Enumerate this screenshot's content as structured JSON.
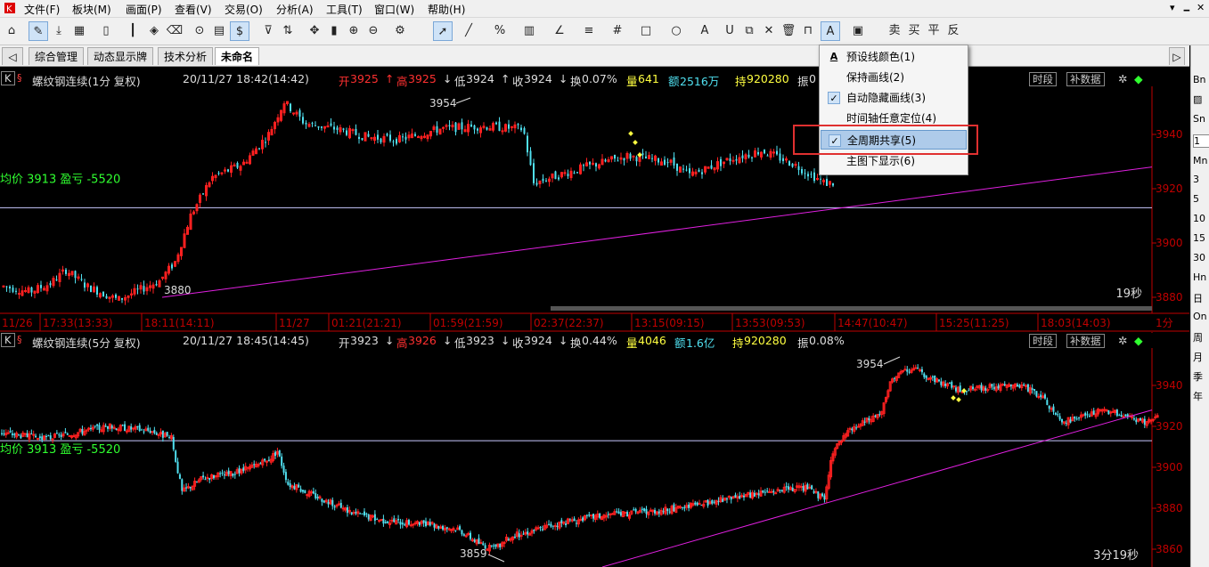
{
  "menu": [
    "文件(F)",
    "板块(M)",
    "画面(P)",
    "查看(V)",
    "交易(O)",
    "分析(A)",
    "工具(T)",
    "窗口(W)",
    "帮助(H)"
  ],
  "window_controls": {
    "restore": "▾",
    "min": "🗕",
    "close": "✕"
  },
  "toolbar": {
    "sell": "卖",
    "buy": "买",
    "flat": "平",
    "reverse": "反"
  },
  "tabs": [
    "综合管理",
    "动态显示牌",
    "技术分析",
    "未命名"
  ],
  "sidebar": [
    "Bn",
    "",
    "Sn",
    "1",
    "Mn",
    "3",
    "5",
    "10",
    "15",
    "30",
    "Hn",
    "日",
    "On",
    "周",
    "月",
    "季",
    "年"
  ],
  "chart1": {
    "k_btn": "K",
    "instrument": "螺纹钢连续(1分 复权)",
    "datetime": "20/11/27 18:42(14:42)",
    "open_label": "开",
    "open": "3925",
    "open_arrow": "↑",
    "high_label": "高",
    "high": "3925",
    "high_arrow": "↓",
    "low_label": "低",
    "low": "3924",
    "low_arrow": "↑",
    "close_label": "收",
    "close": "3924",
    "close_arrow": "↓",
    "turnover_label": "换",
    "turnover": "0.07%",
    "volume_label": "量",
    "volume": "641",
    "amount_label": "额",
    "amount": "2516万",
    "oi_label": "持",
    "oi": "920280",
    "amp_label": "振",
    "amp": "0",
    "btn_period": "时段",
    "btn_data": "补数据",
    "avg_text": "均价 3913 盈亏 -5520",
    "peak_label": "3954",
    "trough_label": "3880",
    "countdown": "19秒",
    "y_ticks": [
      "3940",
      "3920",
      "3900",
      "3880"
    ],
    "x_labels": [
      "11/26",
      "17:33(13:33)",
      "18:11(14:11)",
      "11/27",
      "01:21(21:21)",
      "01:59(21:59)",
      "02:37(22:37)",
      "13:15(09:15)",
      "13:53(09:53)",
      "14:47(10:47)",
      "15:25(11:25)",
      "18:03(14:03)"
    ],
    "period_label": "1分"
  },
  "chart2": {
    "k_btn": "K",
    "instrument": "螺纹钢连续(5分 复权)",
    "datetime": "20/11/27 18:45(14:45)",
    "open_label": "开",
    "open": "3923",
    "open_arrow": "↓",
    "high_label": "高",
    "high": "3926",
    "high_arrow": "↓",
    "low_label": "低",
    "low": "3923",
    "low_arrow": "↓",
    "close_label": "收",
    "close": "3924",
    "close_arrow": "↓",
    "turnover_label": "换",
    "turnover": "0.44%",
    "volume_label": "量",
    "volume": "4046",
    "amount_label": "额",
    "amount": "1.6亿",
    "oi_label": "持",
    "oi": "920280",
    "amp_label": "振",
    "amp": "0.08%",
    "btn_period": "时段",
    "btn_data": "补数据",
    "avg_text": "均价 3913 盈亏 -5520",
    "peak_label": "3954",
    "trough_label": "3859",
    "countdown": "3分19秒",
    "y_ticks": [
      "3940",
      "3920",
      "3900",
      "3880",
      "3860"
    ]
  },
  "dropdown": [
    {
      "label": "预设线颜色(1)",
      "checked": false,
      "icon": "A"
    },
    {
      "label": "保持画线(2)",
      "checked": false,
      "icon": ""
    },
    {
      "label": "自动隐藏画线(3)",
      "checked": true,
      "icon": ""
    },
    {
      "label": "时间轴任意定位(4)",
      "checked": false,
      "icon": ""
    },
    {
      "label": "全周期共享(5)",
      "checked": true,
      "icon": ""
    },
    {
      "label": "主图下显示(6)",
      "checked": false,
      "icon": ""
    }
  ],
  "colors": {
    "up": "#ff2020",
    "down": "#50e0f0",
    "axis": "#c00000",
    "ma_line": "#c8c8ff",
    "trend": "#e020e0",
    "text_yellow": "#ffff40",
    "green": "#30ff30"
  }
}
